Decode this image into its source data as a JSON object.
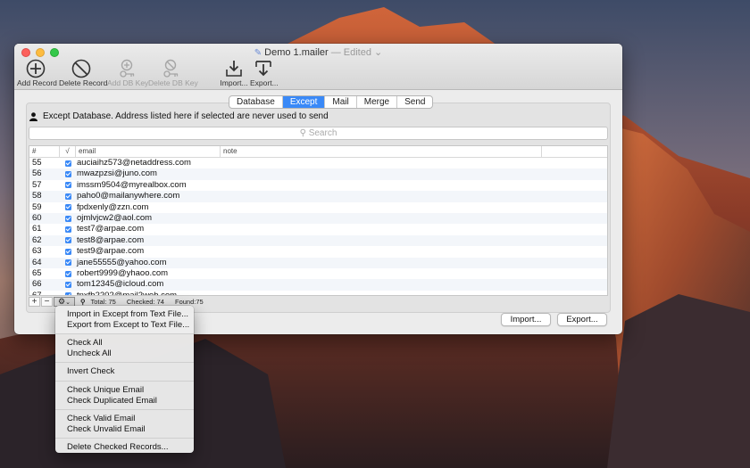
{
  "window": {
    "title": "Demo 1.mailer",
    "title_status": " — Edited ⌄"
  },
  "toolbar": {
    "items": [
      {
        "label": "Add Record",
        "icon": "add-icon",
        "enabled": true
      },
      {
        "label": "Delete Record",
        "icon": "delete-icon",
        "enabled": true
      },
      {
        "label": "Add DB Key",
        "icon": "add-key-icon",
        "enabled": false
      },
      {
        "label": "Delete DB Key",
        "icon": "delete-key-icon",
        "enabled": false
      },
      {
        "label": "Import...",
        "icon": "import-icon",
        "enabled": true
      },
      {
        "label": "Export...",
        "icon": "export-icon",
        "enabled": true
      }
    ]
  },
  "tabs": [
    {
      "label": "Database",
      "active": false
    },
    {
      "label": "Except",
      "active": true
    },
    {
      "label": "Mail",
      "active": false
    },
    {
      "label": "Merge",
      "active": false
    },
    {
      "label": "Send",
      "active": false
    }
  ],
  "info_text": "Except Database. Address listed here if selected are never used to send",
  "search": {
    "placeholder": "Search"
  },
  "table": {
    "columns": [
      "#",
      "√",
      "email",
      "note"
    ],
    "rows": [
      {
        "num": "55",
        "checked": true,
        "email": "auciaihz573@netaddress.com",
        "note": ""
      },
      {
        "num": "56",
        "checked": true,
        "email": "mwazpzsi@juno.com",
        "note": ""
      },
      {
        "num": "57",
        "checked": true,
        "email": "imssm9504@myrealbox.com",
        "note": ""
      },
      {
        "num": "58",
        "checked": true,
        "email": "paho0@mailanywhere.com",
        "note": ""
      },
      {
        "num": "59",
        "checked": true,
        "email": "fpdxenly@zzn.com",
        "note": ""
      },
      {
        "num": "60",
        "checked": true,
        "email": "ojmlvjcw2@aol.com",
        "note": ""
      },
      {
        "num": "61",
        "checked": true,
        "email": "test7@arpae.com",
        "note": ""
      },
      {
        "num": "62",
        "checked": true,
        "email": "test8@arpae.com",
        "note": ""
      },
      {
        "num": "63",
        "checked": true,
        "email": "test9@arpae.com",
        "note": ""
      },
      {
        "num": "64",
        "checked": true,
        "email": "jane55555@yahoo.com",
        "note": ""
      },
      {
        "num": "65",
        "checked": true,
        "email": "robert9999@yhaoo.com",
        "note": ""
      },
      {
        "num": "66",
        "checked": true,
        "email": "tom12345@icloud.com",
        "note": ""
      },
      {
        "num": "67",
        "checked": true,
        "email": "tnxfh2202@mail2web.com",
        "note": ""
      }
    ]
  },
  "status": {
    "total": "Total: 75",
    "checked": "Checked: 74",
    "found": "Found:75"
  },
  "buttons": {
    "import": "Import...",
    "export": "Export..."
  },
  "menu": {
    "groups": [
      [
        "Import in Except from Text File...",
        "Export from Except to Text File..."
      ],
      [
        "Check All",
        "Uncheck All"
      ],
      [
        "Invert Check"
      ],
      [
        "Check Unique Email",
        "Check Duplicated Email"
      ],
      [
        "Check Valid  Email",
        "Check Unvalid  Email"
      ],
      [
        "Delete Checked Records..."
      ]
    ]
  }
}
